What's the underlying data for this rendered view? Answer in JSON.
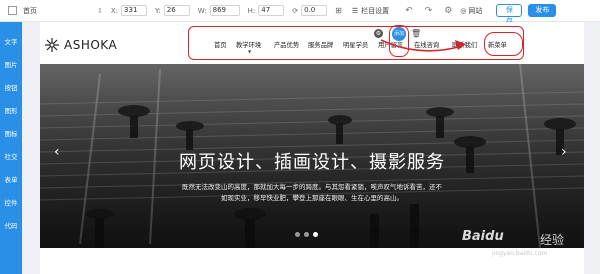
{
  "toolbar": {
    "page_label": "首页",
    "x_label": "X:",
    "x_value": "331",
    "y_label": "Y:",
    "y_value": "26",
    "w_label": "W:",
    "w_value": "869",
    "h_label": "H:",
    "h_value": "47",
    "r_value": "0.0",
    "layer_label": "栏目设置",
    "site_label": "网站",
    "save_label": "保存",
    "publish_label": "发布"
  },
  "sidebar": {
    "items": [
      {
        "label": "文字"
      },
      {
        "label": "图片"
      },
      {
        "label": "按钮"
      },
      {
        "label": "图形"
      },
      {
        "label": "图标"
      },
      {
        "label": "社交"
      },
      {
        "label": "表单"
      },
      {
        "label": "控件"
      },
      {
        "label": "代码"
      }
    ]
  },
  "site": {
    "logo": "ASHOKA",
    "nav": [
      {
        "label": "首页"
      },
      {
        "label": "教学环境"
      },
      {
        "label": "产品优势"
      },
      {
        "label": "服务品牌"
      },
      {
        "label": "明星学员"
      },
      {
        "label": "用户留言"
      },
      {
        "label": "在线咨询"
      },
      {
        "label": "联系我们"
      },
      {
        "label": "新菜单"
      }
    ],
    "add_badge": "添加",
    "banner_title": "网页设计、插画设计、摄影服务",
    "banner_sub_line1": "既然无法改变山的高度，那就加大每一步的跨度。与其怨看紧锁，唉声叹气地诉看苦，还不",
    "banner_sub_line2": "如现实业，移早快业肥，攀登上那座在眼眼、生在心里的高山。"
  },
  "watermark": {
    "brand": "Baidu",
    "cn": "经验",
    "url": "jingyan.baidu.com"
  },
  "colors": {
    "accent": "#2a8fe6",
    "annotation": "#d6262c"
  }
}
